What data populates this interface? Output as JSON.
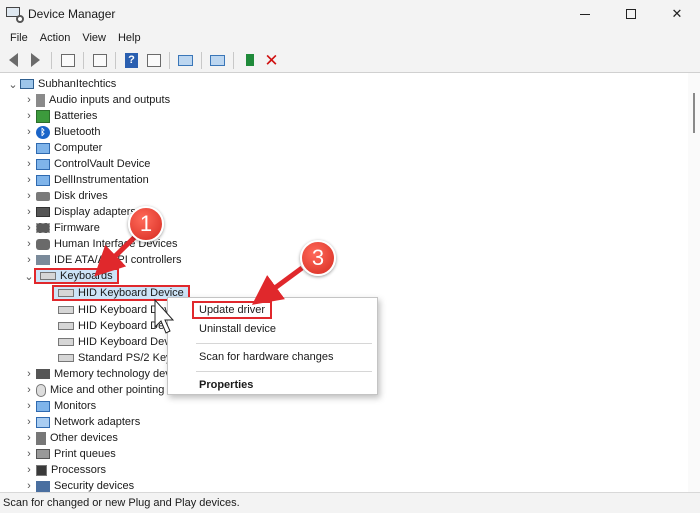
{
  "window": {
    "title": "Device Manager",
    "controls": {
      "minimize": "minimize",
      "maximize": "maximize",
      "close": "✕"
    }
  },
  "menu": [
    "File",
    "Action",
    "View",
    "Help"
  ],
  "toolbar": {
    "icons": [
      "back-arrow-icon",
      "forward-arrow-icon",
      "properties-icon",
      "show-hide-icon",
      "help-icon",
      "scan-icon",
      "monitor-icon",
      "update-driver-icon",
      "uninstall-icon"
    ],
    "help_glyph": "?",
    "uninstall_glyph": "✕"
  },
  "tree": {
    "root": "SubhanItechtics",
    "categories": [
      {
        "label": "Audio inputs and outputs",
        "icon": "speaker-icon"
      },
      {
        "label": "Batteries",
        "icon": "battery-icon"
      },
      {
        "label": "Bluetooth",
        "icon": "bluetooth-icon"
      },
      {
        "label": "Computer",
        "icon": "computer-icon"
      },
      {
        "label": "ControlVault Device",
        "icon": "monitor-icon"
      },
      {
        "label": "DellInstrumentation",
        "icon": "monitor-icon"
      },
      {
        "label": "Disk drives",
        "icon": "disk-icon"
      },
      {
        "label": "Display adapters",
        "icon": "display-adapter-icon"
      },
      {
        "label": "Firmware",
        "icon": "chip-icon"
      },
      {
        "label": "Human Interface Devices",
        "icon": "hid-icon"
      },
      {
        "label": "IDE ATA/ATAPI controllers",
        "icon": "ide-icon"
      },
      {
        "label": "Keyboards",
        "icon": "keyboard-icon"
      }
    ],
    "keyboard_children": [
      "HID Keyboard Device",
      "HID Keyboard Device",
      "HID Keyboard Device",
      "HID Keyboard Device",
      "Standard PS/2 Keyboard"
    ],
    "after_categories": [
      {
        "label": "Memory technology devices",
        "icon": "memory-icon"
      },
      {
        "label": "Mice and other pointing devices",
        "icon": "mouse-icon"
      },
      {
        "label": "Monitors",
        "icon": "monitor-icon"
      },
      {
        "label": "Network adapters",
        "icon": "network-icon"
      },
      {
        "label": "Other devices",
        "icon": "other-device-icon"
      },
      {
        "label": "Print queues",
        "icon": "printer-icon"
      },
      {
        "label": "Processors",
        "icon": "processor-icon"
      },
      {
        "label": "Security devices",
        "icon": "security-icon"
      }
    ],
    "bluetooth_glyph": "ᛒ",
    "chevron_collapsed": "›",
    "chevron_expanded": "⌄"
  },
  "context_menu": {
    "update": "Update driver",
    "uninstall": "Uninstall device",
    "scan": "Scan for hardware changes",
    "properties": "Properties"
  },
  "annotations": {
    "step1": "1",
    "step3": "3",
    "accent": "#e0282c"
  },
  "status": "Scan for changed or new Plug and Play devices."
}
